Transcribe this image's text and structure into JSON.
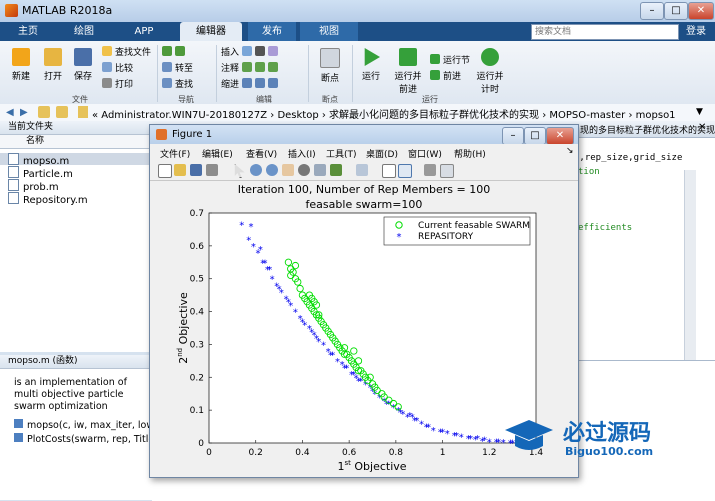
{
  "app": {
    "title": "MATLAB R2018a"
  },
  "tabs": [
    {
      "label": "主页"
    },
    {
      "label": "绘图"
    },
    {
      "label": "APP"
    },
    {
      "label": "编辑器"
    },
    {
      "label": "发布"
    },
    {
      "label": "视图"
    }
  ],
  "search": {
    "placeholder": "搜索文档"
  },
  "login_label": "登录",
  "ribbon": {
    "file": {
      "new": "新建",
      "open": "打开",
      "save": "保存",
      "find_files": "查找文件",
      "compare": "比较",
      "print": "打印",
      "group": "文件"
    },
    "nav": {
      "go_to": "转至",
      "find": "查找",
      "group": "导航"
    },
    "edit": {
      "insert": "插入",
      "comment": "注释",
      "indent": "缩进",
      "group": "编辑"
    },
    "breakpoints": {
      "label": "断点",
      "group": "断点"
    },
    "run": {
      "run": "运行",
      "run_advance": "运行并\n前进",
      "run_section": "运行节",
      "advance": "前进",
      "run_time": "运行并\n计时",
      "group": "运行"
    }
  },
  "address": {
    "path": "« Administrator.WIN7U-20180127Z  ›  Desktop  ›  求解最小化问题的多目标粒子群优化技术的实现  ›  MOPSO-master  ›  mopso1"
  },
  "current_folder": {
    "header": "当前文件夹",
    "column": "名称",
    "files": [
      {
        "name": "mopso.m"
      },
      {
        "name": "Particle.m"
      },
      {
        "name": "prob.m"
      },
      {
        "name": "Repository.m"
      }
    ]
  },
  "details": {
    "header": "mopso.m  (函数)",
    "description": "is an implementation of multi objective particle swarm optimization",
    "functions": [
      {
        "sig": "mopso(c, iw, max_iter, lowe"
      },
      {
        "sig": "PlotCosts(swarm, rep, Title)"
      }
    ]
  },
  "editor": {
    "tab_title": "现的多目标粒子群优化技术的实现\\MOP...",
    "line1": "s,rep_size,grid_size",
    "line2": "tion",
    "line3": "efficients"
  },
  "figure": {
    "title": "Figure 1",
    "menu": [
      "文件(F)",
      "编辑(E)",
      "查看(V)",
      "插入(I)",
      "工具(T)",
      "桌面(D)",
      "窗口(W)",
      "帮助(H)"
    ]
  },
  "chart_data": {
    "type": "scatter",
    "title": "Iteration 100, Number of Rep Members = 100",
    "subtitle": "feasable swarm=100",
    "xlabel": "1st Objective",
    "ylabel": "2nd Objective",
    "xlim": [
      0,
      1.4
    ],
    "ylim": [
      0,
      0.7
    ],
    "xticks": [
      0,
      0.2,
      0.4,
      0.6,
      0.8,
      1,
      1.2,
      1.4
    ],
    "yticks": [
      0,
      0.1,
      0.2,
      0.3,
      0.4,
      0.5,
      0.6,
      0.7
    ],
    "legend_position": "top-right",
    "series": [
      {
        "name": "Current feasable SWARM",
        "marker": "circle",
        "color": "#00dd00",
        "x": [
          0.34,
          0.35,
          0.36,
          0.37,
          0.38,
          0.39,
          0.4,
          0.41,
          0.42,
          0.43,
          0.43,
          0.44,
          0.45,
          0.45,
          0.46,
          0.46,
          0.47,
          0.48,
          0.49,
          0.5,
          0.51,
          0.52,
          0.53,
          0.54,
          0.55,
          0.56,
          0.57,
          0.58,
          0.59,
          0.6,
          0.61,
          0.62,
          0.63,
          0.64,
          0.65,
          0.66,
          0.67,
          0.68,
          0.7,
          0.71,
          0.72,
          0.74,
          0.75,
          0.77,
          0.79,
          0.81,
          0.35,
          0.37,
          0.44,
          0.47,
          0.58,
          0.62,
          0.64,
          0.69
        ],
        "y": [
          0.55,
          0.53,
          0.52,
          0.5,
          0.49,
          0.47,
          0.45,
          0.44,
          0.43,
          0.45,
          0.42,
          0.41,
          0.4,
          0.43,
          0.39,
          0.42,
          0.38,
          0.37,
          0.36,
          0.35,
          0.34,
          0.33,
          0.32,
          0.31,
          0.3,
          0.29,
          0.28,
          0.27,
          0.27,
          0.26,
          0.25,
          0.24,
          0.23,
          0.22,
          0.22,
          0.21,
          0.2,
          0.19,
          0.18,
          0.17,
          0.16,
          0.15,
          0.14,
          0.13,
          0.12,
          0.11,
          0.51,
          0.54,
          0.44,
          0.39,
          0.29,
          0.28,
          0.25,
          0.2
        ]
      },
      {
        "name": "REPASITORY",
        "marker": "star",
        "color": "#0000ee",
        "x": [
          0.14,
          0.17,
          0.19,
          0.21,
          0.23,
          0.25,
          0.27,
          0.29,
          0.31,
          0.33,
          0.35,
          0.37,
          0.39,
          0.41,
          0.43,
          0.45,
          0.47,
          0.49,
          0.51,
          0.53,
          0.55,
          0.57,
          0.59,
          0.61,
          0.63,
          0.65,
          0.67,
          0.69,
          0.71,
          0.73,
          0.75,
          0.77,
          0.79,
          0.81,
          0.83,
          0.85,
          0.87,
          0.89,
          0.91,
          0.93,
          0.96,
          0.99,
          1.02,
          1.05,
          1.08,
          1.11,
          1.14,
          1.17,
          1.2,
          1.23,
          1.26,
          1.29,
          1.32,
          1.35,
          0.18,
          0.22,
          0.26,
          0.3,
          0.34,
          0.4,
          0.46,
          0.52,
          0.58,
          0.64,
          0.7,
          0.76,
          0.82,
          0.88,
          0.94,
          1.0,
          1.06,
          1.12,
          1.18,
          1.24,
          1.3,
          0.24,
          0.44,
          0.62,
          0.86,
          1.15
        ],
        "y": [
          0.665,
          0.62,
          0.6,
          0.58,
          0.55,
          0.53,
          0.5,
          0.48,
          0.46,
          0.44,
          0.42,
          0.4,
          0.38,
          0.36,
          0.35,
          0.33,
          0.31,
          0.3,
          0.28,
          0.27,
          0.25,
          0.24,
          0.23,
          0.21,
          0.2,
          0.19,
          0.18,
          0.17,
          0.15,
          0.14,
          0.13,
          0.12,
          0.11,
          0.1,
          0.09,
          0.08,
          0.08,
          0.07,
          0.06,
          0.05,
          0.04,
          0.035,
          0.03,
          0.025,
          0.02,
          0.015,
          0.012,
          0.008,
          0.005,
          0.004,
          0.003,
          0.002,
          0.001,
          0.0,
          0.66,
          0.59,
          0.53,
          0.47,
          0.43,
          0.37,
          0.32,
          0.27,
          0.23,
          0.19,
          0.16,
          0.12,
          0.095,
          0.07,
          0.05,
          0.035,
          0.025,
          0.015,
          0.01,
          0.005,
          0.002,
          0.55,
          0.34,
          0.21,
          0.085,
          0.015
        ]
      }
    ]
  }
}
